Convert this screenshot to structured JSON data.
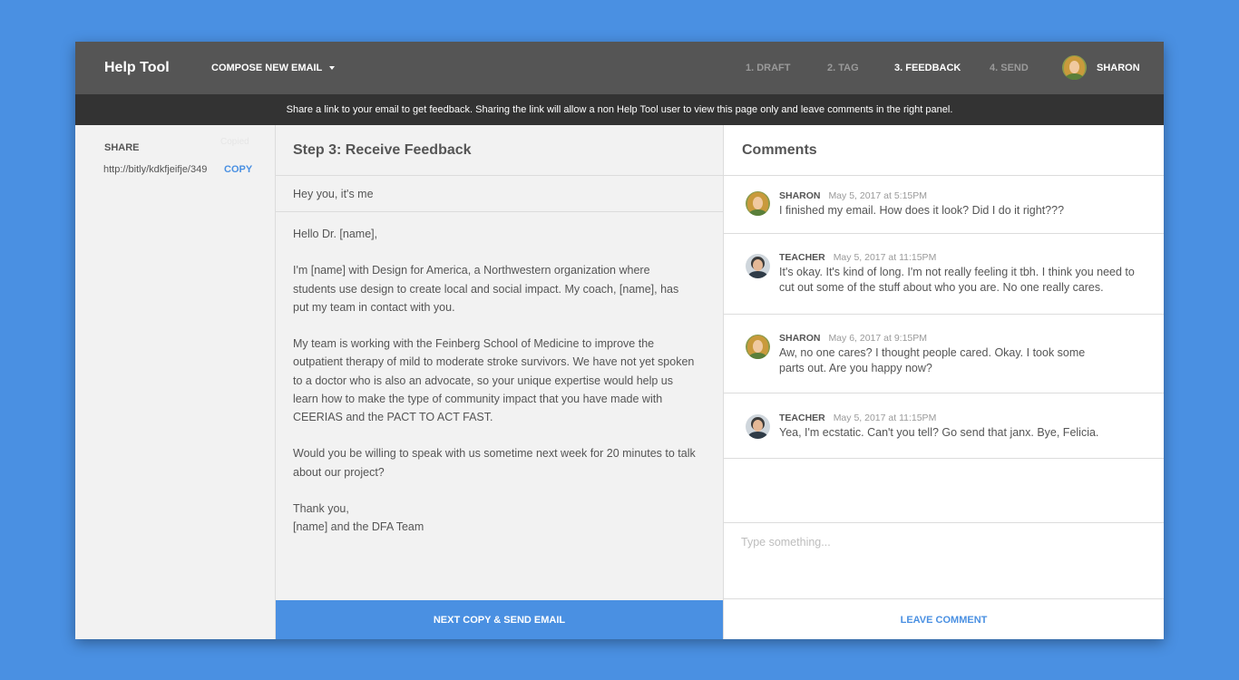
{
  "header": {
    "app_title": "Help Tool",
    "compose_label": "COMPOSE NEW EMAIL",
    "steps": [
      {
        "label": "1. DRAFT",
        "active": false
      },
      {
        "label": "2. TAG",
        "active": false
      },
      {
        "label": "3. FEEDBACK",
        "active": true
      },
      {
        "label": "4. SEND",
        "active": false
      }
    ],
    "user_name": "SHARON"
  },
  "banner": {
    "text": "Share a link to your email to get feedback. Sharing the link will allow a non Help Tool user to view this page only and leave comments in the right panel."
  },
  "share": {
    "label": "SHARE",
    "copied_label": "Copied",
    "url": "http://bitly/kdkfjeifje/349",
    "copy_label": "COPY"
  },
  "draft": {
    "title": "Step 3: Receive Feedback",
    "subject": "Hey you, it's me",
    "paragraphs": [
      "Hello Dr. [name],",
      "I'm [name] with Design for America, a Northwestern organization where students use design to create local and social impact. My coach, [name], has put my team in contact with you.",
      "My team is working with the Feinberg School of Medicine to improve the outpatient therapy of mild to moderate stroke survivors. We have not yet spoken to a doctor who is also an advocate, so your unique expertise would help us learn how to make the type of community impact that you have made with CEERIAS and the PACT TO ACT FAST.",
      "Would you be willing to speak with us sometime next week for 20 minutes to talk about our project?"
    ],
    "signoff_1": "Thank you,",
    "signoff_2": "[name] and the DFA Team",
    "next_button": "NEXT COPY & SEND EMAIL"
  },
  "comments": {
    "title": "Comments",
    "items": [
      {
        "author": "SHARON",
        "time": "May 5, 2017 at 5:15PM",
        "text": "I finished my email. How does it look? Did I do it right???",
        "avatar": "sharon-avatar"
      },
      {
        "author": "TEACHER",
        "time": "May 5, 2017 at 11:15PM",
        "text": "It's okay. It's kind of long. I'm not really feeling it tbh. I think you need to cut out some of the stuff about who you are. No one really cares.",
        "avatar": "teacher-avatar"
      },
      {
        "author": "SHARON",
        "time": "May 6, 2017 at 9:15PM",
        "text": "Aw, no one cares? I thought people cared. Okay. I took some parts out. Are you happy now?",
        "avatar": "sharon-avatar"
      },
      {
        "author": "TEACHER",
        "time": "May 5, 2017 at 11:15PM",
        "text": "Yea, I'm ecstatic. Can't you tell? Go send that janx. Bye, Felicia.",
        "avatar": "teacher-avatar"
      }
    ],
    "input_placeholder": "Type something...",
    "leave_button": "LEAVE COMMENT"
  },
  "colors": {
    "background": "#4a90e2",
    "header": "#555555",
    "banner": "#333333",
    "accent": "#4a90e2"
  }
}
